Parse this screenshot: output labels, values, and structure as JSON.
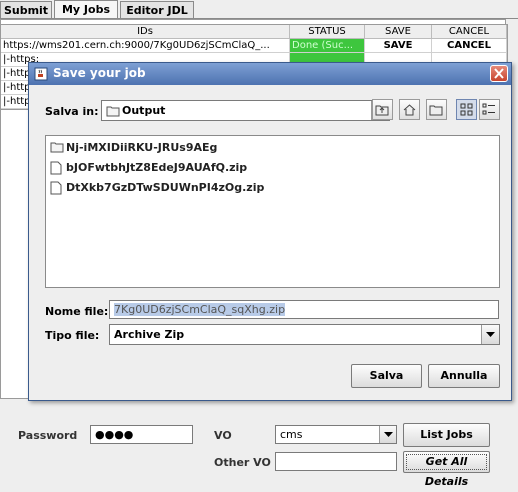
{
  "tabs": [
    {
      "label": "Submit"
    },
    {
      "label": "My Jobs"
    },
    {
      "label": "Editor JDL"
    }
  ],
  "table": {
    "columns": [
      "IDs",
      "STATUS",
      "SAVE",
      "CANCEL"
    ],
    "rows": [
      {
        "id": "https://wms201.cern.ch:9000/7Kg0UD6zjSCmClaQ_...",
        "status": "Done (Suc...",
        "save": "SAVE",
        "cancel": "CANCEL"
      },
      {
        "id": "|-https:",
        "status": "",
        "save": "",
        "cancel": ""
      },
      {
        "id": "|-http",
        "status": "",
        "save": "",
        "cancel": ""
      },
      {
        "id": "|-http",
        "status": "",
        "save": "",
        "cancel": ""
      },
      {
        "id": "|-http",
        "status": "",
        "save": "",
        "cancel": ""
      }
    ]
  },
  "dialog": {
    "title": "Save your job",
    "look_in_label": "Salva in:",
    "look_in_value": "Output",
    "files": [
      {
        "name": "Nj-iMXIDiiRKU-JRUs9AEg",
        "type": "folder"
      },
      {
        "name": "bJOFwtbhJtZ8EdeJ9AUAfQ.zip",
        "type": "file"
      },
      {
        "name": "DtXkb7GzDTwSDUWnPI4zOg.zip",
        "type": "file"
      }
    ],
    "filename_label": "Nome file:",
    "filename_value": "7Kg0UD6zjSCmClaQ_sqXhg.zip",
    "filetype_label": "Tipo file:",
    "filetype_value": "Archive Zip",
    "save_button": "Salva",
    "cancel_button": "Annulla"
  },
  "bottom": {
    "password_label": "Password",
    "password_value": "●●●●",
    "vo_label": "VO",
    "vo_value": "cms",
    "other_vo_label": "Other VO",
    "other_vo_value": "",
    "list_jobs_button": "List Jobs",
    "get_details_button": "Get All Details"
  },
  "colors": {
    "status_done": "#3ec63e",
    "titlebar": "#4d72b0",
    "close_button": "#c8442e"
  }
}
